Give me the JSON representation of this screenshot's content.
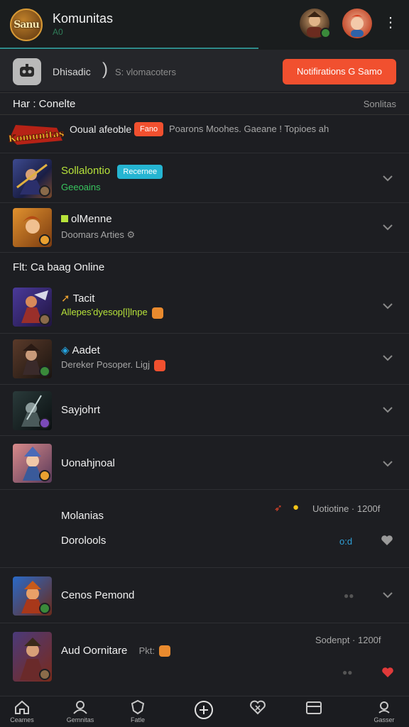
{
  "header": {
    "logo_text": "Sanu",
    "title": "Komunitas",
    "subtitle": "A0"
  },
  "toolbar": {
    "label": "Dhisadic",
    "separator": ")",
    "search_placeholder": "S: vlomacoters",
    "notify_button": "Notifirations G Samo"
  },
  "section1": {
    "left": "Har : Conelte",
    "right": "Sonlitas"
  },
  "featured": {
    "logo_text": "Komunitas",
    "title": "Ooual afeoble",
    "badge": "Fano",
    "desc": "Poarons Moohes. Gaeane ! Topioes ah"
  },
  "rows_top": [
    {
      "title": "Sollalontio",
      "badge": "Recernee",
      "sub": "Geeoains"
    },
    {
      "title": "olMenne",
      "sub": "Doomars Arties"
    }
  ],
  "section2": {
    "label": "Flt: Ca baag Online"
  },
  "rows_mid": [
    {
      "title": "Tacit",
      "sub": "Allepes'dyesop[l]lnpe"
    },
    {
      "title": "Aadet",
      "sub": "Dereker Posoper. Ligj"
    },
    {
      "title": "Sayjohrt"
    },
    {
      "title": "Uonahjnoal"
    }
  ],
  "post_block": {
    "line1": "Molanias",
    "line2": "Dorolools",
    "meta": "Uotiotine · 1200f",
    "link": "o:d"
  },
  "rows_bottom": [
    {
      "title": "Cenos Pemond"
    },
    {
      "title": "Aud Oornitare",
      "tag": "Pkt:",
      "meta": "Sodenpt · 1200f"
    }
  ],
  "nav": {
    "items": [
      {
        "label": "Ceames",
        "icon": "home-icon"
      },
      {
        "label": "Gemnitas",
        "icon": "community-icon"
      },
      {
        "label": "Fatle",
        "icon": "shield-icon"
      },
      {
        "label": "",
        "icon": "plus-circle-icon"
      },
      {
        "label": "",
        "icon": "heart-x-icon"
      },
      {
        "label": "",
        "icon": "card-icon"
      },
      {
        "label": "Gasser",
        "icon": "settings-icon"
      }
    ]
  },
  "colors": {
    "accent": "#f1502f",
    "teal": "#2f8b8b",
    "green": "#38c45e",
    "lime": "#b7e33a",
    "cyan": "#25b5d2"
  }
}
